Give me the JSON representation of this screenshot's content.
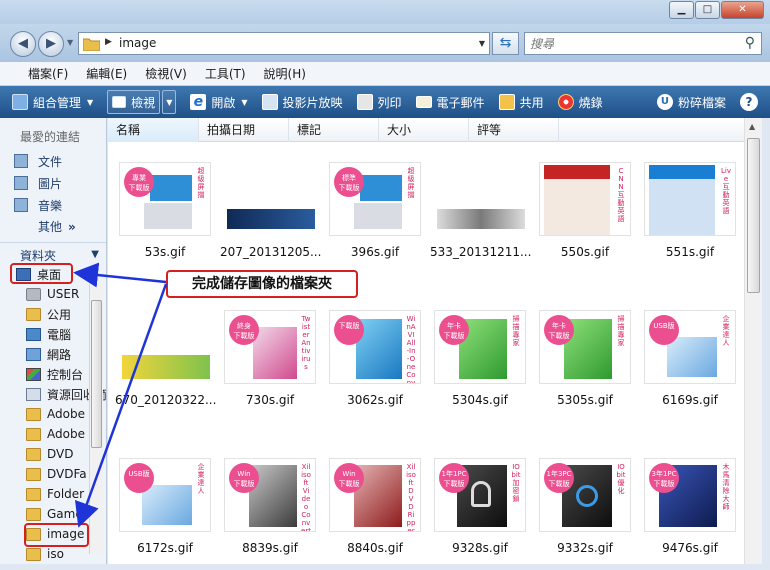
{
  "window": {
    "minimize": "▁",
    "maximize": "□",
    "close": "✕"
  },
  "address": {
    "back": "◀",
    "forward": "▶",
    "path": "image",
    "search_placeholder": "搜尋"
  },
  "menu": [
    "檔案(F)",
    "編輯(E)",
    "檢視(V)",
    "工具(T)",
    "說明(H)"
  ],
  "toolbar": {
    "organize": "組合管理",
    "views": "檢視",
    "open": "開啟",
    "slideshow": "投影片放映",
    "print": "列印",
    "email": "電子郵件",
    "share": "共用",
    "burn": "燒錄",
    "shred": "粉碎檔案",
    "help": "?"
  },
  "nav": {
    "favorites_heading": "最愛的連結",
    "favorites": [
      "文件",
      "圖片",
      "音樂"
    ],
    "more": "其他",
    "more_chevron": "»",
    "folders_label": "資料夾",
    "tree": [
      {
        "label": "桌面",
        "icon": "desktop-icon"
      },
      {
        "label": "USER",
        "icon": "user-icon"
      },
      {
        "label": "公用",
        "icon": "folder-icon"
      },
      {
        "label": "電腦",
        "icon": "computer-icon"
      },
      {
        "label": "網路",
        "icon": "network-icon"
      },
      {
        "label": "控制台",
        "icon": "control-panel-icon"
      },
      {
        "label": "資源回收筒",
        "icon": "recycle-bin-icon"
      },
      {
        "label": "Adobe",
        "icon": "folder-icon"
      },
      {
        "label": "Adobe",
        "icon": "folder-icon"
      },
      {
        "label": "DVD",
        "icon": "folder-icon"
      },
      {
        "label": "DVDFa",
        "icon": "folder-icon"
      },
      {
        "label": "Folder",
        "icon": "folder-icon"
      },
      {
        "label": "Game",
        "icon": "folder-icon"
      },
      {
        "label": "image",
        "icon": "folder-icon"
      },
      {
        "label": "iso",
        "icon": "folder-icon"
      }
    ]
  },
  "columns": [
    "名稱",
    "拍攝日期",
    "標記",
    "大小",
    "評等"
  ],
  "files": [
    {
      "name": "53s.gif",
      "badge": "專業\n下載版",
      "side": "超級屏擋"
    },
    {
      "name": "207_20131205...",
      "badge": "",
      "side": ""
    },
    {
      "name": "396s.gif",
      "badge": "標準\n下載版",
      "side": "超級屏擋"
    },
    {
      "name": "533_20131211...",
      "badge": "",
      "side": ""
    },
    {
      "name": "550s.gif",
      "badge": "",
      "side": "CNN互動英語"
    },
    {
      "name": "551s.gif",
      "badge": "",
      "side": "Live互動英語"
    },
    {
      "name": "670_20120322...",
      "badge": "",
      "side": ""
    },
    {
      "name": "730s.gif",
      "badge": "終身\n下載版",
      "side": "Twister Antivirus"
    },
    {
      "name": "3062s.gif",
      "badge": "下載版",
      "side": "WinAVI All-In-One Converter"
    },
    {
      "name": "5304s.gif",
      "badge": "年卡\n下載版",
      "side": "掃描專家"
    },
    {
      "name": "5305s.gif",
      "badge": "年卡\n下載版",
      "side": "掃描專家"
    },
    {
      "name": "6169s.gif",
      "badge": "USB版",
      "side": "企業達人"
    },
    {
      "name": "6172s.gif",
      "badge": "USB版",
      "side": "企業達人"
    },
    {
      "name": "8839s.gif",
      "badge": "Win\n下載版",
      "side": "Xilisoft Video Converter"
    },
    {
      "name": "8840s.gif",
      "badge": "Win\n下載版",
      "side": "Xilisoft DVD Ripper"
    },
    {
      "name": "9328s.gif",
      "badge": "1年1PC\n下載版",
      "side": "IObit 加密鎖"
    },
    {
      "name": "9332s.gif",
      "badge": "1年3PC\n下載版",
      "side": "IObit 優化"
    },
    {
      "name": "9476s.gif",
      "badge": "3年1PC\n下載版",
      "side": "木馬清除大師"
    }
  ],
  "annotation": {
    "callout": "完成儲存圖像的檔案夾"
  },
  "colors": {
    "toolbar": "#1f4f87",
    "highlight": "#d62020",
    "arrow": "#1f34d8",
    "badge": "#ec4f8f"
  }
}
